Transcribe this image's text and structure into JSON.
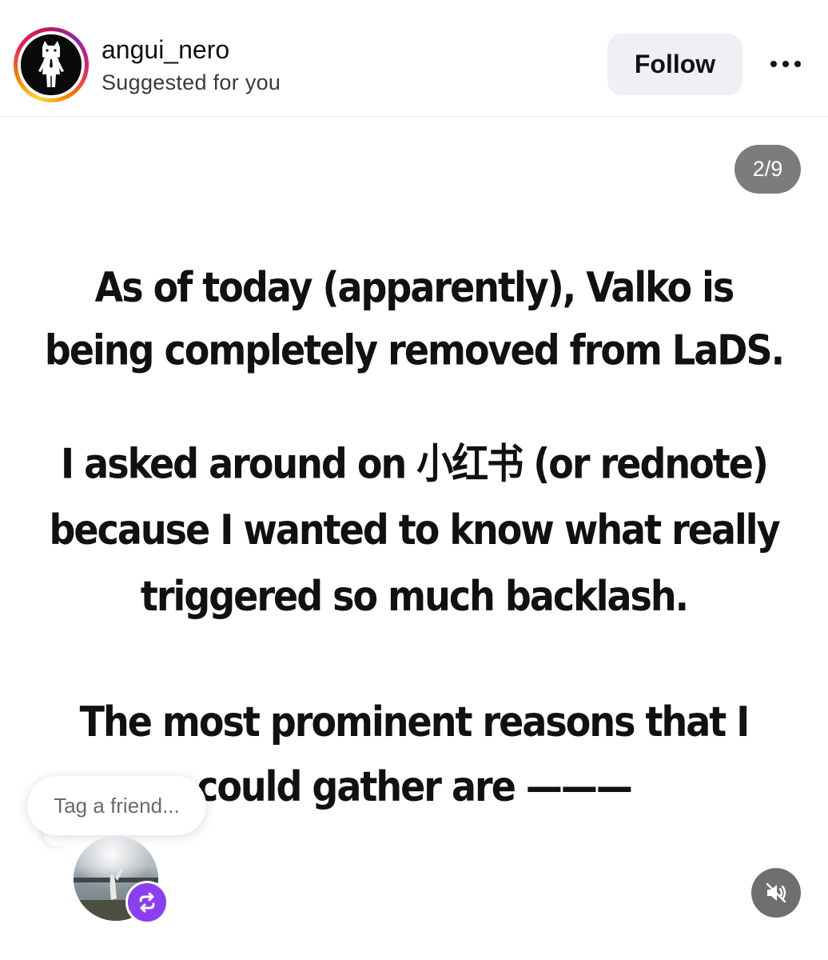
{
  "post_header": {
    "username": "angui_nero",
    "subtitle": "Suggested for you",
    "follow_label": "Follow",
    "more_icon": "more-horizontal-icon",
    "ring_colors": [
      "#fdd835",
      "#f57c00",
      "#e91e63",
      "#8e24aa"
    ]
  },
  "carousel": {
    "counter": "2/9",
    "current_index": 2,
    "total": 9
  },
  "slide": {
    "paragraph1": [
      "As of today (apparently), Valko is",
      "being completely removed from LaDS."
    ],
    "paragraph2": [
      "I asked around on 小红书 (or rednote)",
      "because I wanted to know what really",
      "triggered so much backlash."
    ],
    "paragraph3": [
      "The most prominent reasons that I",
      "could gather are ———"
    ]
  },
  "tag_prompt": {
    "placeholder": "Tag a friend...",
    "avatar_icon": "friend-avatar",
    "badge_icon": "repost-icon",
    "badge_color": "#8b3ff0"
  },
  "media_controls": {
    "mute_icon": "speaker-muted-icon"
  }
}
